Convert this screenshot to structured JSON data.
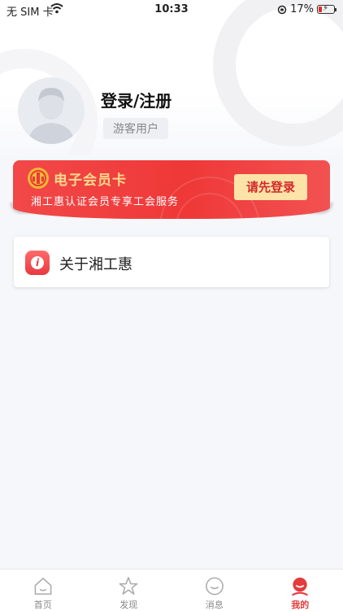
{
  "status_bar": {
    "carrier": "无 SIM 卡",
    "time": "10:33",
    "battery": "17%"
  },
  "profile": {
    "title": "登录/注册",
    "badge": "游客用户"
  },
  "member_card": {
    "title": "电子会员卡",
    "subtitle": "湘工惠认证会员专享工会服务",
    "button": "请先登录"
  },
  "menu": {
    "about": "关于湘工惠"
  },
  "tabbar": {
    "items": [
      {
        "label": "首页",
        "icon": "home-icon"
      },
      {
        "label": "发现",
        "icon": "star-icon"
      },
      {
        "label": "消息",
        "icon": "message-icon"
      },
      {
        "label": "我的",
        "icon": "profile-icon"
      }
    ],
    "active_index": 3
  },
  "colors": {
    "accent": "#e53b3b",
    "card_red": "#ef3838",
    "card_gold": "#ffd98a"
  }
}
